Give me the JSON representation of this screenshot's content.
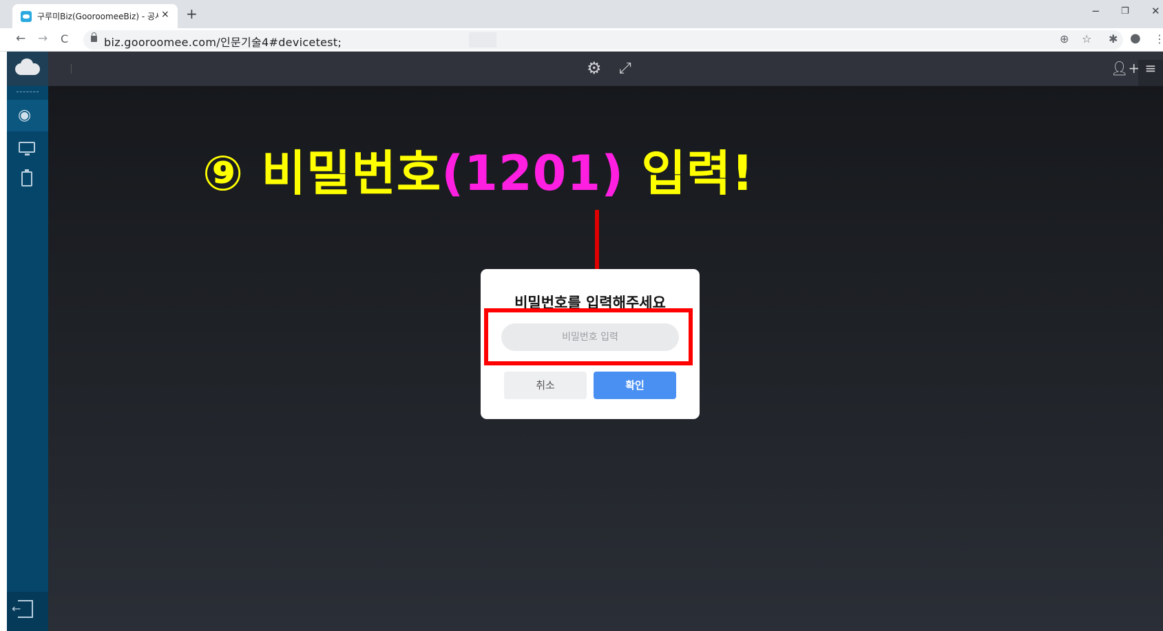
{
  "browser": {
    "tab_title": "구루미Biz(GooroomeeBiz) - 공사",
    "tab_close": "×",
    "new_tab": "+",
    "url": "biz.gooroomee.com/인문기술4#devicetest;",
    "window_controls": [
      "−",
      "❐",
      "✕"
    ]
  },
  "app": {
    "header_icons": [
      "settings-icon",
      "fullscreen-icon",
      "add-user-icon",
      "menu-icon"
    ],
    "sidebar_items": [
      "profile-icon",
      "monitor-icon",
      "clipboard-icon"
    ]
  },
  "annotation": {
    "circled_number": "⑨",
    "text_before": "비밀번호",
    "text_highlight": "(1201)",
    "text_after": "입력!",
    "colors": {
      "yellow": "#ffff00",
      "magenta": "#ff1fe1",
      "red": "#ff0000"
    }
  },
  "dialog": {
    "title": "비밀번호를 입력해주세요",
    "input_placeholder": "비밀번호 입력",
    "cancel_label": "취소",
    "confirm_label": "확인",
    "confirm_color": "#4a90f2"
  }
}
